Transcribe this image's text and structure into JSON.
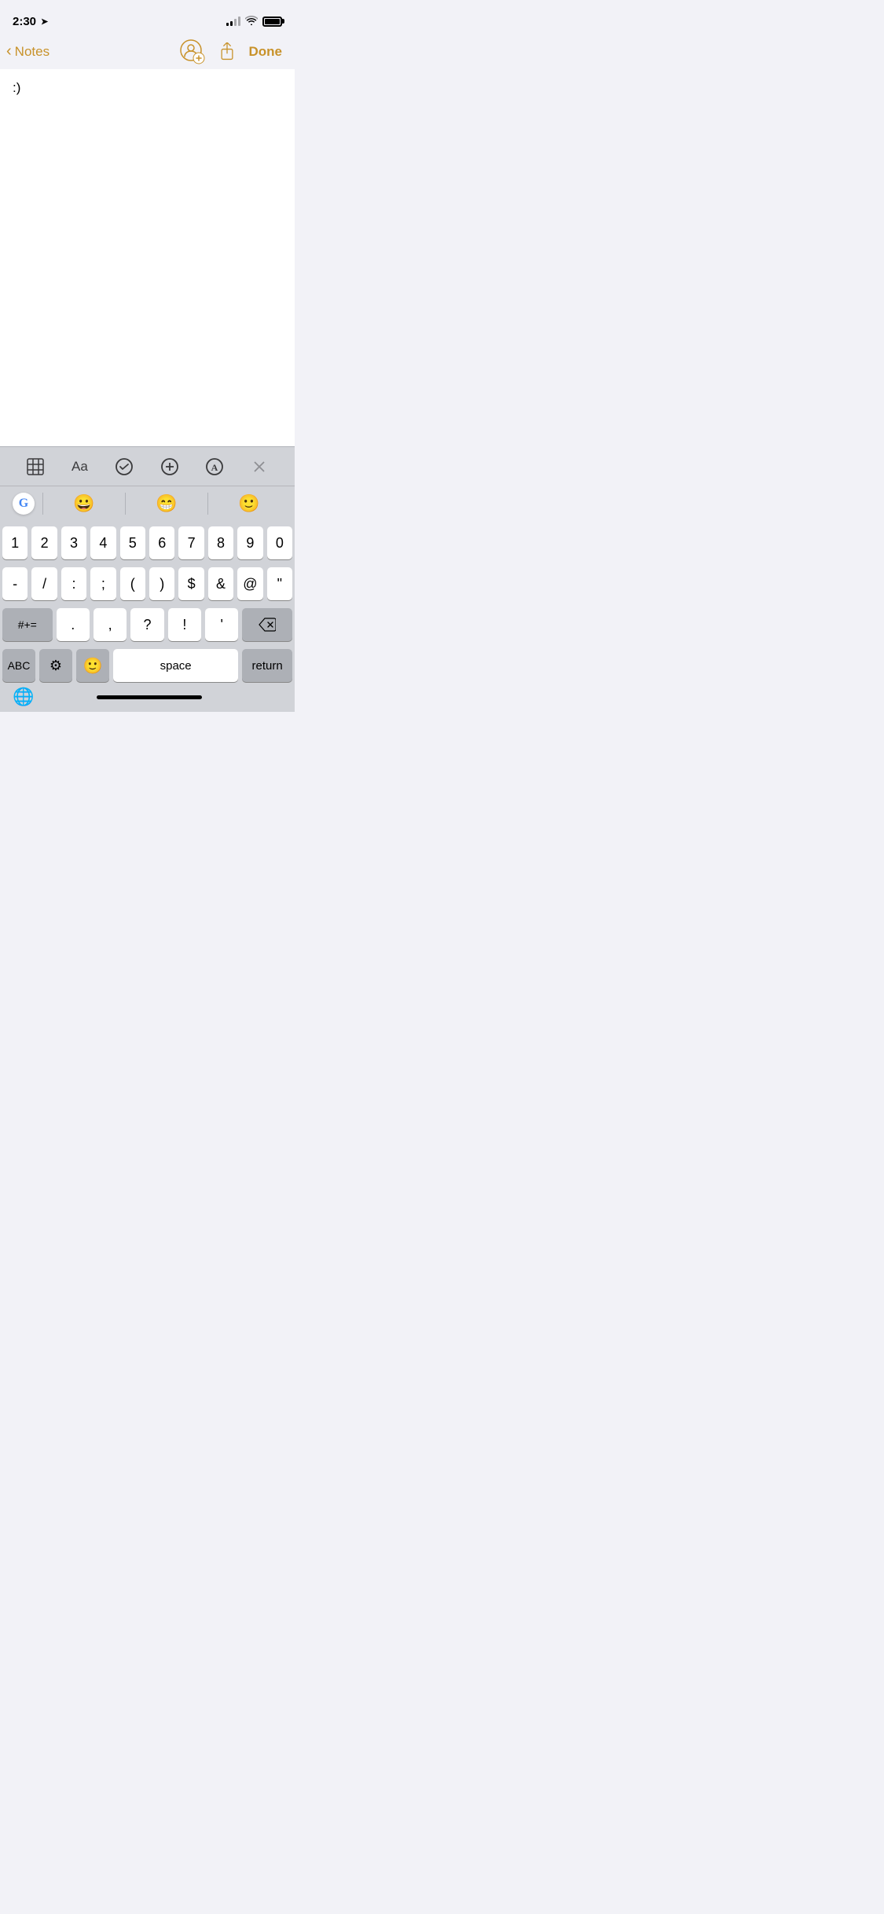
{
  "statusBar": {
    "time": "2:30",
    "locationIcon": "➤"
  },
  "navBar": {
    "backLabel": "Notes",
    "doneLabel": "Done"
  },
  "note": {
    "content": ":)"
  },
  "formattingToolbar": {
    "buttons": [
      {
        "name": "table",
        "label": "⊞"
      },
      {
        "name": "font",
        "label": "Aa"
      },
      {
        "name": "checklist",
        "label": "✓"
      },
      {
        "name": "add",
        "label": "+"
      },
      {
        "name": "markup",
        "label": "A"
      },
      {
        "name": "close",
        "label": "✕"
      }
    ]
  },
  "suggestionBar": {
    "emojis": [
      "😀",
      "😁",
      "🙂"
    ]
  },
  "keyboard": {
    "row1": [
      "1",
      "2",
      "3",
      "4",
      "5",
      "6",
      "7",
      "8",
      "9",
      "0"
    ],
    "row2": [
      "-",
      "/",
      ":",
      ";",
      "(",
      ")",
      "$",
      "&",
      "@",
      "\""
    ],
    "row3Special": "#+=",
    "row3": [
      ".",
      ",",
      "?",
      "!",
      "'"
    ],
    "row4": {
      "abc": "ABC",
      "space": "space",
      "return": "return"
    }
  },
  "bottomBar": {
    "globeIcon": "🌐"
  }
}
